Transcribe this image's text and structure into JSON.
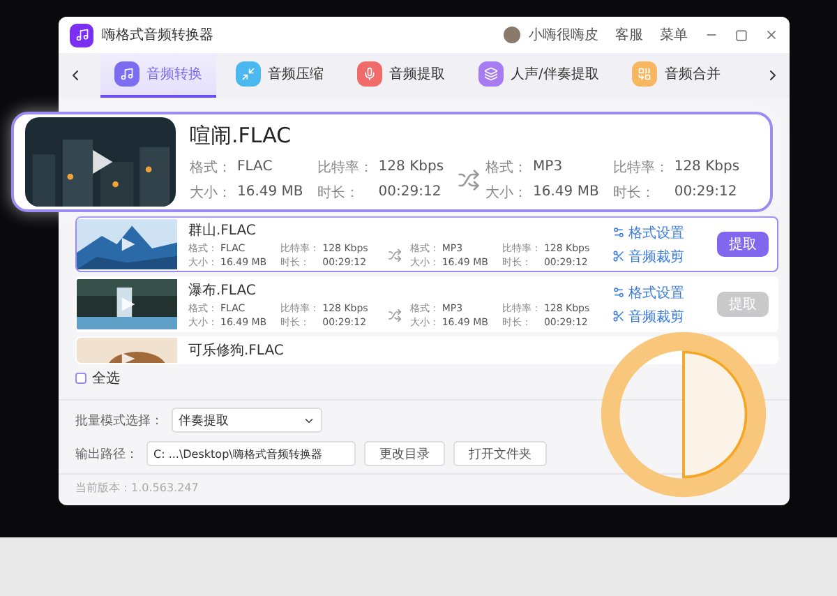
{
  "window": {
    "title": "嗨格式音频转换器",
    "user": "小嗨很嗨皮",
    "menu": [
      "客服",
      "菜单"
    ]
  },
  "tabs": [
    {
      "label": "音频转换",
      "selected": true,
      "color": "#7b6cf0"
    },
    {
      "label": "音频压缩",
      "selected": false,
      "color": "#4cb8f0"
    },
    {
      "label": "音频提取",
      "selected": false,
      "color": "#f06a6a"
    },
    {
      "label": "人声/伴奏提取",
      "selected": false,
      "color": "#a77cf2"
    },
    {
      "label": "音频合并",
      "selected": false,
      "color": "#f7b760"
    }
  ],
  "featured": {
    "name": "喧闹.FLAC",
    "source": [
      {
        "label": "格式：",
        "value": "FLAC"
      },
      {
        "label": "比特率：",
        "value": "128 Kbps"
      },
      {
        "label": "大小：",
        "value": "16.49 MB"
      },
      {
        "label": "时长：",
        "value": "00:29:12"
      }
    ],
    "target": [
      {
        "label": "格式：",
        "value": "MP3"
      },
      {
        "label": "比特率：",
        "value": "128 Kbps"
      },
      {
        "label": "大小：",
        "value": "16.49 MB"
      },
      {
        "label": "时长：",
        "value": "00:29:12"
      }
    ]
  },
  "rows": [
    {
      "name": "群山.FLAC",
      "selected": true,
      "source": [
        {
          "label": "格式：",
          "value": "FLAC"
        },
        {
          "label": "比特率：",
          "value": "128 Kbps"
        },
        {
          "label": "大小：",
          "value": "16.49 MB"
        },
        {
          "label": "时长：",
          "value": "00:29:12"
        }
      ],
      "target": [
        {
          "label": "格式：",
          "value": "MP3"
        },
        {
          "label": "比特率：",
          "value": "128 Kbps"
        },
        {
          "label": "大小：",
          "value": "16.49 MB"
        },
        {
          "label": "时长：",
          "value": "00:29:12"
        }
      ],
      "actions": [
        "格式设置",
        "音频裁剪"
      ],
      "button": {
        "label": "提取",
        "disabled": false
      }
    },
    {
      "name": "瀑布.FLAC",
      "selected": false,
      "source": [
        {
          "label": "格式：",
          "value": "FLAC"
        },
        {
          "label": "比特率：",
          "value": "128 Kbps"
        },
        {
          "label": "大小：",
          "value": "16.49 MB"
        },
        {
          "label": "时长：",
          "value": "00:29:12"
        }
      ],
      "target": [
        {
          "label": "格式：",
          "value": "MP3"
        },
        {
          "label": "比特率：",
          "value": "128 Kbps"
        },
        {
          "label": "大小：",
          "value": "16.49 MB"
        },
        {
          "label": "时长：",
          "value": "00:29:12"
        }
      ],
      "actions": [
        "格式设置",
        "音频裁剪"
      ],
      "button": {
        "label": "提取",
        "disabled": true
      }
    },
    {
      "name": "可乐修狗.FLAC",
      "selected": false
    }
  ],
  "select_all": {
    "label": "全选",
    "checked": false
  },
  "batch_mode": {
    "label": "批量模式选择：",
    "value": "伴奏提取"
  },
  "output_path": {
    "label": "输出路径：",
    "value": "C: ...\\Desktop\\嗨格式音频转换器",
    "buttons": [
      "更改目录",
      "打开文件夹"
    ]
  },
  "version": "当前版本：1.0.563.247"
}
